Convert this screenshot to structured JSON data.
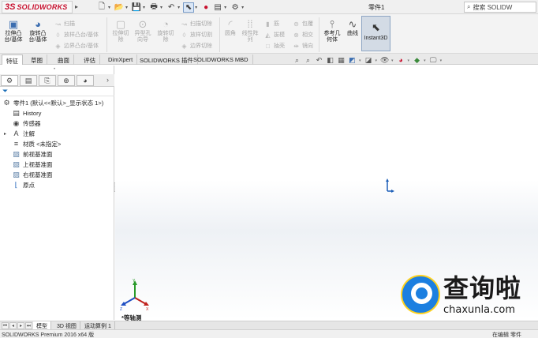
{
  "app": {
    "logo_ds": "3S",
    "logo_brand": "SOLIDWORKS",
    "doc_title": "零件1",
    "search_placeholder": "搜索 SOLIDW"
  },
  "ribbon": {
    "extrude_boss": "拉伸凸\n台/基体",
    "revolve_boss": "旋转凸\n台/基体",
    "sweep": "扫描",
    "loft": "放样凸台/基体",
    "boundary": "边界凸台/基体",
    "extrude_cut": "拉伸切\n除",
    "hole_wizard": "异型孔\n向导",
    "revolve_cut": "旋转切\n除",
    "swept_cut": "扫描切除",
    "lofted_cut": "放样切割",
    "boundary_cut": "边界切除",
    "fillet": "圆角",
    "linear_pattern": "线性阵\n列",
    "rib": "筋",
    "draft": "拔模",
    "shell": "抽壳",
    "wrap": "包覆",
    "intersect": "相交",
    "mirror": "镜向",
    "reference_geometry": "参考几\n何体",
    "curves": "曲线",
    "instant3d": "Instant3D"
  },
  "tabs": [
    "特征",
    "草图",
    "曲面",
    "评估",
    "DimXpert",
    "SOLIDWORKS 插件",
    "SOLIDWORKS MBD"
  ],
  "tree": {
    "root": "零件1 (默认<<默认>_显示状态 1>)",
    "items": [
      {
        "label": "History",
        "icon": "history-icon"
      },
      {
        "label": "传感器",
        "icon": "sensor-icon"
      },
      {
        "label": "注解",
        "icon": "annotation-icon"
      },
      {
        "label": "材质 <未指定>",
        "icon": "material-icon"
      },
      {
        "label": "前视基准面",
        "icon": "plane-icon"
      },
      {
        "label": "上视基准面",
        "icon": "plane-icon"
      },
      {
        "label": "右视基准面",
        "icon": "plane-icon"
      },
      {
        "label": "原点",
        "icon": "origin-icon"
      }
    ]
  },
  "viewport": {
    "view_name": "*等轴测"
  },
  "watermark": {
    "title": "查询啦",
    "url": "chaxunla.com"
  },
  "bottom_tabs": [
    "模型",
    "3D 视图",
    "运动算例 1"
  ],
  "status": {
    "left": "SOLIDWORKS Premium 2016 x64 版",
    "right": "在编辑 零件"
  },
  "colors": {
    "brand_red": "#c8102e",
    "origin_blue": "#1d5fb8",
    "triad_x": "#c0201c",
    "triad_y": "#2a9a2a",
    "triad_z": "#1f4fc4"
  }
}
